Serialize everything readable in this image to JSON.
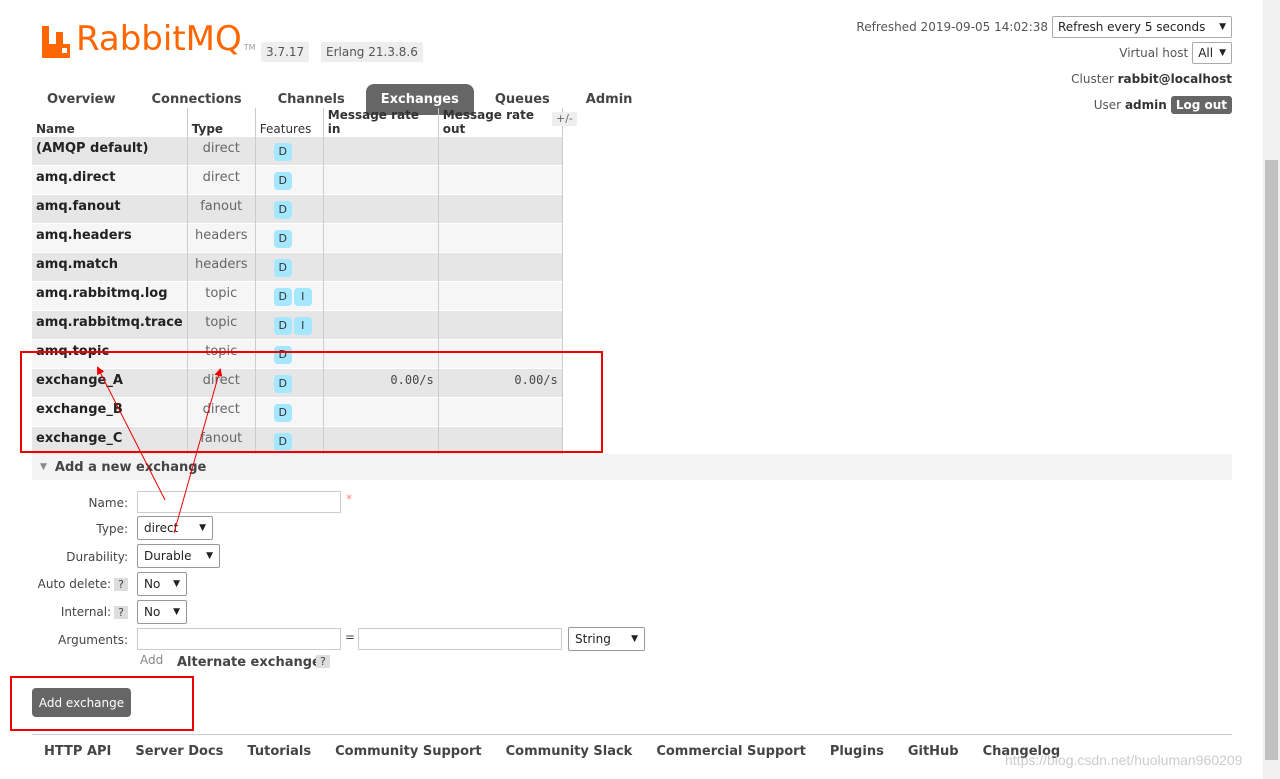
{
  "brand": {
    "name": "RabbitMQ",
    "tm": "TM",
    "version": "3.7.17",
    "erlang": "Erlang 21.3.8.6",
    "color": "#ff6600"
  },
  "header": {
    "refreshed_label": "Refreshed 2019-09-05 14:02:38",
    "refresh_select": "Refresh every 5 seconds",
    "vhost_label": "Virtual host",
    "vhost_select": "All",
    "cluster_label": "Cluster",
    "cluster_value": "rabbit@localhost",
    "user_label": "User",
    "user_value": "admin",
    "logout": "Log out"
  },
  "tabs": [
    "Overview",
    "Connections",
    "Channels",
    "Exchanges",
    "Queues",
    "Admin"
  ],
  "active_tab": "Exchanges",
  "table": {
    "headers": [
      "Name",
      "Type",
      "Features",
      "Message rate in",
      "Message rate out"
    ],
    "plusminus": "+/-",
    "rows": [
      {
        "name": "(AMQP default)",
        "type": "direct",
        "features": [
          "D"
        ],
        "rate_in": "",
        "rate_out": ""
      },
      {
        "name": "amq.direct",
        "type": "direct",
        "features": [
          "D"
        ],
        "rate_in": "",
        "rate_out": ""
      },
      {
        "name": "amq.fanout",
        "type": "fanout",
        "features": [
          "D"
        ],
        "rate_in": "",
        "rate_out": ""
      },
      {
        "name": "amq.headers",
        "type": "headers",
        "features": [
          "D"
        ],
        "rate_in": "",
        "rate_out": ""
      },
      {
        "name": "amq.match",
        "type": "headers",
        "features": [
          "D"
        ],
        "rate_in": "",
        "rate_out": ""
      },
      {
        "name": "amq.rabbitmq.log",
        "type": "topic",
        "features": [
          "D",
          "I"
        ],
        "rate_in": "",
        "rate_out": ""
      },
      {
        "name": "amq.rabbitmq.trace",
        "type": "topic",
        "features": [
          "D",
          "I"
        ],
        "rate_in": "",
        "rate_out": ""
      },
      {
        "name": "amq.topic",
        "type": "topic",
        "features": [
          "D"
        ],
        "rate_in": "",
        "rate_out": ""
      },
      {
        "name": "exchange_A",
        "type": "direct",
        "features": [
          "D"
        ],
        "rate_in": "0.00/s",
        "rate_out": "0.00/s"
      },
      {
        "name": "exchange_B",
        "type": "direct",
        "features": [
          "D"
        ],
        "rate_in": "",
        "rate_out": ""
      },
      {
        "name": "exchange_C",
        "type": "fanout",
        "features": [
          "D"
        ],
        "rate_in": "",
        "rate_out": ""
      }
    ]
  },
  "add_section": {
    "title": "Add a new exchange",
    "name_label": "Name:",
    "name_value": "",
    "required_mark": "*",
    "type_label": "Type:",
    "type_value": "direct",
    "durability_label": "Durability:",
    "durability_value": "Durable",
    "auto_delete_label": "Auto delete:",
    "auto_delete_value": "No",
    "internal_label": "Internal:",
    "internal_value": "No",
    "help_mark": "?",
    "arguments_label": "Arguments:",
    "eq": "=",
    "arg_type_value": "String",
    "add_link": "Add",
    "alternate_exchange": "Alternate exchange",
    "submit": "Add exchange"
  },
  "footer": [
    "HTTP API",
    "Server Docs",
    "Tutorials",
    "Community Support",
    "Community Slack",
    "Commercial Support",
    "Plugins",
    "GitHub",
    "Changelog"
  ],
  "watermark": "https://blog.csdn.net/huoluman960209",
  "annotation_color": "#ee0000"
}
